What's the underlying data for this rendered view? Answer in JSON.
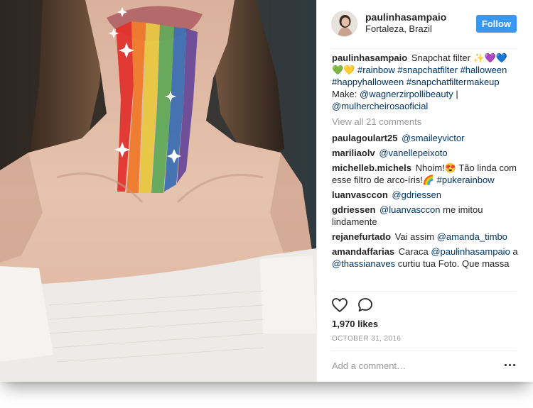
{
  "post": {
    "username": "paulinhasampaio",
    "location": "Fortaleza, Brazil",
    "follow_label": "Follow",
    "caption": {
      "user": "paulinhasampaio",
      "parts": [
        {
          "t": "text",
          "v": " Snapchat filter ✨💜💙💚💛 "
        },
        {
          "t": "link",
          "v": "#rainbow"
        },
        {
          "t": "text",
          "v": " "
        },
        {
          "t": "link",
          "v": "#snapchatfilter"
        },
        {
          "t": "text",
          "v": " "
        },
        {
          "t": "link",
          "v": "#halloween"
        },
        {
          "t": "text",
          "v": " "
        },
        {
          "t": "link",
          "v": "#happyhalloween"
        },
        {
          "t": "text",
          "v": " "
        },
        {
          "t": "link",
          "v": "#snapchatfiltermakeup"
        },
        {
          "t": "text",
          "v": " Make: "
        },
        {
          "t": "link",
          "v": "@wagnerzirpollibeauty"
        },
        {
          "t": "text",
          "v": " | "
        },
        {
          "t": "link",
          "v": "@mulhercheirosaoficial"
        }
      ]
    },
    "view_all_comments": "View all 21 comments",
    "comments": [
      {
        "user": "paulagoulart25",
        "parts": [
          {
            "t": "link",
            "v": "@smaileyvictor"
          }
        ]
      },
      {
        "user": "mariliaolv",
        "parts": [
          {
            "t": "link",
            "v": "@vanellepeixoto"
          }
        ]
      },
      {
        "user": "michelleb.michels",
        "parts": [
          {
            "t": "text",
            "v": "Nhoim!😍 Tão linda com esse filtro de arco-íris!🌈 "
          },
          {
            "t": "link",
            "v": "#pukerainbow"
          }
        ]
      },
      {
        "user": "luanvasccon",
        "parts": [
          {
            "t": "link",
            "v": "@gdriessen"
          }
        ]
      },
      {
        "user": "gdriessen",
        "parts": [
          {
            "t": "link",
            "v": "@luanvasccon"
          },
          {
            "t": "text",
            "v": " me imitou lindamente"
          }
        ]
      },
      {
        "user": "rejanefurtado",
        "parts": [
          {
            "t": "text",
            "v": "Vai assim "
          },
          {
            "t": "link",
            "v": "@amanda_timbo"
          }
        ]
      },
      {
        "user": "amandaffarias",
        "parts": [
          {
            "t": "text",
            "v": "Caraca "
          },
          {
            "t": "link",
            "v": "@paulinhasampaio"
          },
          {
            "t": "text",
            "v": " a "
          },
          {
            "t": "link",
            "v": "@thassianaves"
          },
          {
            "t": "text",
            "v": " curtiu tua Foto. Que massa"
          }
        ]
      }
    ],
    "likes": "1,970 likes",
    "date": "OCTOBER 31, 2016",
    "add_comment_placeholder": "Add a comment…"
  },
  "icons": {
    "like": "heart-outline-icon",
    "comment": "comment-bubble-icon",
    "more": "more-options-icon"
  },
  "colors": {
    "follow_button": "#3897f0",
    "link": "#003569",
    "muted": "#999999",
    "text": "#262626"
  }
}
